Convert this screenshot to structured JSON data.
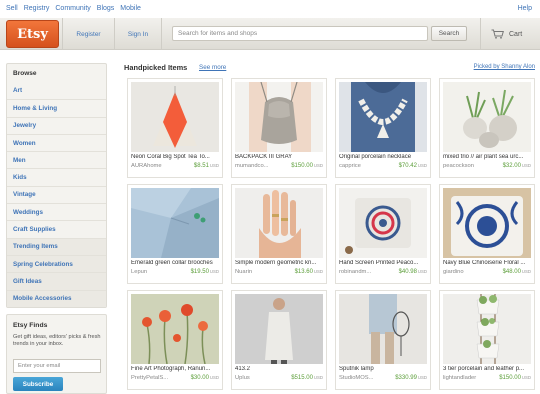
{
  "topbar": {
    "links": [
      "Sell",
      "Registry",
      "Community",
      "Blogs",
      "Mobile"
    ],
    "help": "Help"
  },
  "header": {
    "logo": "Etsy",
    "register": "Register",
    "sign_in": "Sign In",
    "search_placeholder": "Search for items and shops",
    "search_button": "Search",
    "cart": "Cart"
  },
  "sidebar": {
    "title": "Browse",
    "items": [
      "Art",
      "Home & Living",
      "Jewelry",
      "Women",
      "Men",
      "Kids",
      "Vintage",
      "Weddings",
      "Craft Supplies",
      "Trending Items",
      "Spring Celebrations",
      "Gift Ideas",
      "Mobile Accessories"
    ]
  },
  "finds": {
    "title": "Etsy Finds",
    "text": "Get gift ideas, editors' picks & fresh trends in your inbox.",
    "email_placeholder": "Enter your email",
    "subscribe": "Subscribe"
  },
  "main": {
    "title": "Handpicked Items",
    "see_more": "See more",
    "picked_by": "Picked by Shanny Alon"
  },
  "products": [
    {
      "title": "Neon Coral Big Spot Tea To...",
      "shop": "AURAhome",
      "price": "$8.51",
      "currency": "USD"
    },
    {
      "title": "BACKPACK III GRAY",
      "shop": "mumandco...",
      "price": "$150.00",
      "currency": "USD"
    },
    {
      "title": "Original porcelain necklace",
      "shop": "capprice",
      "price": "$70.42",
      "currency": "USD"
    },
    {
      "title": "mixed trio // air plant sea urc...",
      "shop": "peacockson",
      "price": "$32.00",
      "currency": "USD"
    },
    {
      "title": "Emerald green collar brooches",
      "shop": "Lepun",
      "price": "$19.50",
      "currency": "USD"
    },
    {
      "title": "Simple modern geometric kn...",
      "shop": "Nuarin",
      "price": "$13.60",
      "currency": "USD"
    },
    {
      "title": "Hand Screen Printed Peaco...",
      "shop": "robinandm...",
      "price": "$40.98",
      "currency": "USD"
    },
    {
      "title": "Navy Blue Chinoiserie Floral ...",
      "shop": "giardino",
      "price": "$48.00",
      "currency": "USD"
    },
    {
      "title": "Fine Art Photograph, Ranun...",
      "shop": "PrettyPetalS...",
      "price": "$30.00",
      "currency": "USD"
    },
    {
      "title": "413.2",
      "shop": "Uplus",
      "price": "$515.00",
      "currency": "USD"
    },
    {
      "title": "Sputnik lamp",
      "shop": "StudioMOS...",
      "price": "$330.99",
      "currency": "USD"
    },
    {
      "title": "3 tier porcelain and leather p...",
      "shop": "lightandlader",
      "price": "$150.00",
      "currency": "USD"
    }
  ],
  "colors": {
    "brand_orange": "#f1641e",
    "link_blue": "#3f74b7",
    "price_green": "#5c9e3a",
    "subscribe_blue": "#3796cf"
  }
}
